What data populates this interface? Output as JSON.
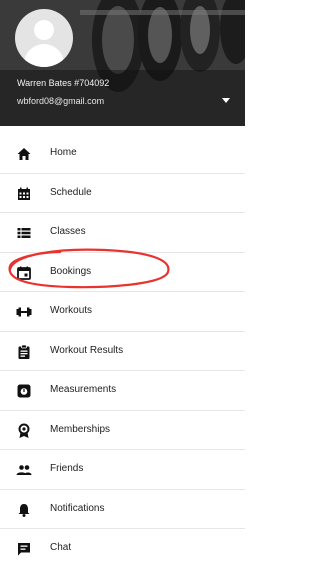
{
  "header": {
    "user_name": "Warren Bates #704092",
    "user_email": "wbford08@gmail.com",
    "background": "gym-dumbbells-photo"
  },
  "menu": {
    "items": [
      {
        "label": "Home",
        "icon": "home-icon"
      },
      {
        "label": "Schedule",
        "icon": "calendar-grid-icon"
      },
      {
        "label": "Classes",
        "icon": "list-icon"
      },
      {
        "label": "Bookings",
        "icon": "calendar-event-icon"
      },
      {
        "label": "Workouts",
        "icon": "dumbbell-icon"
      },
      {
        "label": "Workout Results",
        "icon": "clipboard-icon"
      },
      {
        "label": "Measurements",
        "icon": "scale-icon"
      },
      {
        "label": "Memberships",
        "icon": "badge-icon"
      },
      {
        "label": "Friends",
        "icon": "people-icon"
      },
      {
        "label": "Notifications",
        "icon": "bell-icon"
      },
      {
        "label": "Chat",
        "icon": "chat-icon"
      }
    ]
  },
  "annotation": {
    "target": "Bookings",
    "shape": "ellipse",
    "color": "#e8332e"
  }
}
